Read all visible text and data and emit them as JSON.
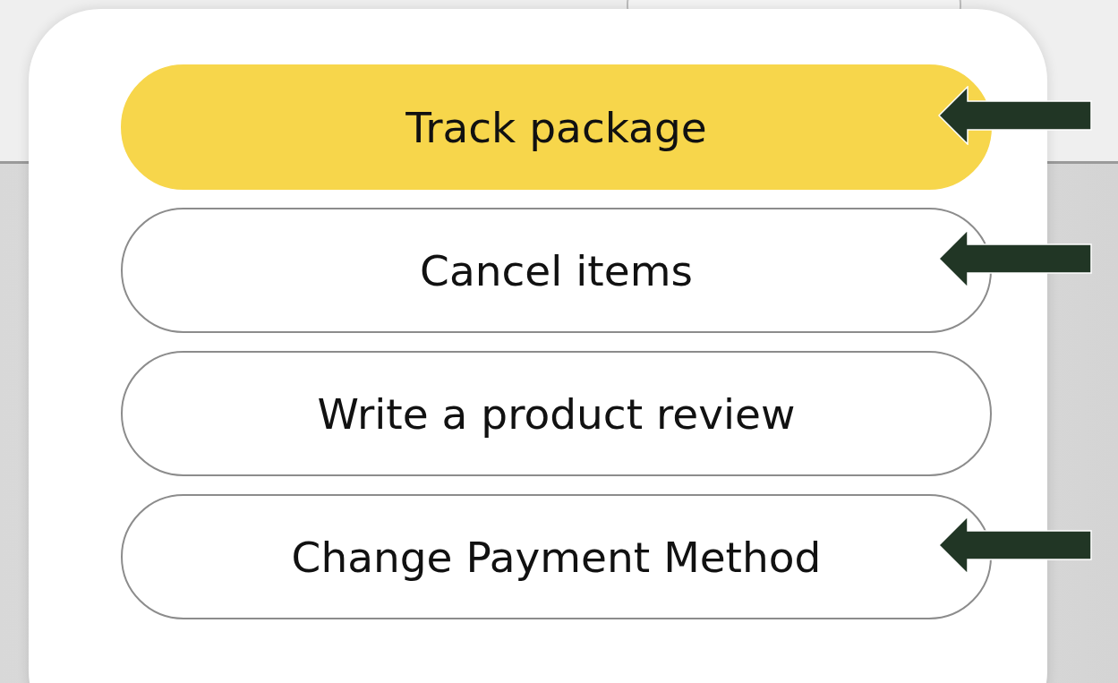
{
  "buttons": [
    {
      "label": "Track package",
      "kind": "primary",
      "arrow": true
    },
    {
      "label": "Cancel items",
      "kind": "secondary",
      "arrow": true
    },
    {
      "label": "Write a product review",
      "kind": "secondary",
      "arrow": false
    },
    {
      "label": "Change Payment Method",
      "kind": "secondary",
      "arrow": true
    }
  ]
}
